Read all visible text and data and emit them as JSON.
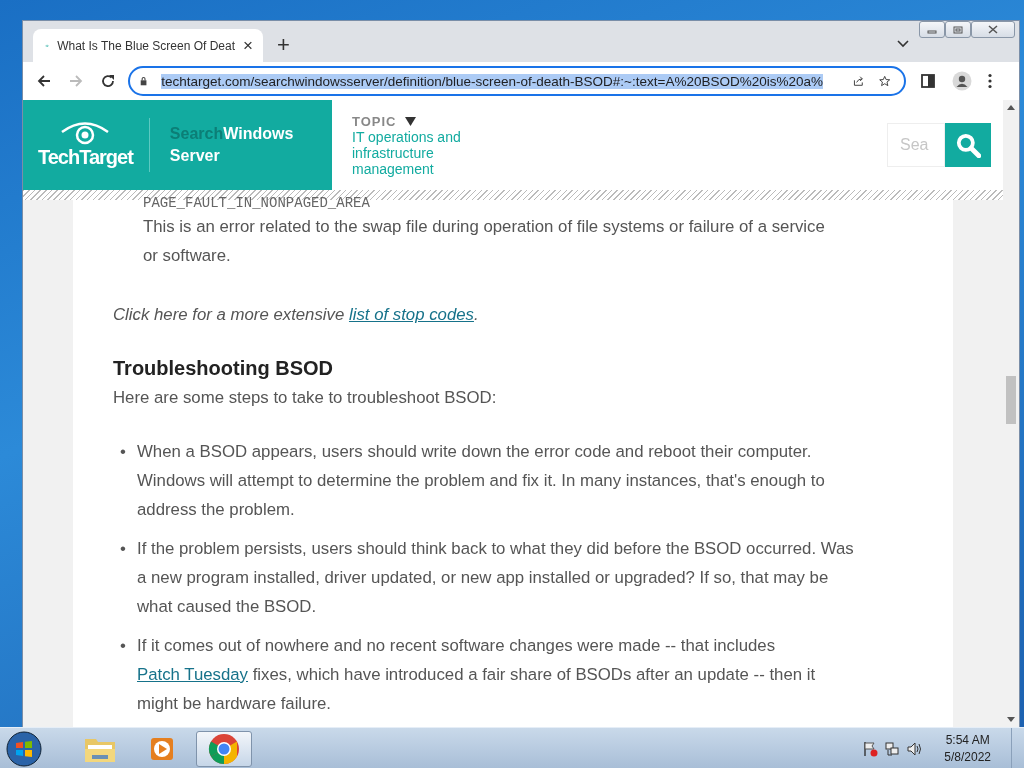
{
  "browser": {
    "tab": {
      "title": "What Is The Blue Screen Of Deat",
      "close": "×",
      "selected": true
    },
    "new_tab": "+",
    "address": {
      "url": "techtarget.com/searchwindowsserver/definition/blue-screen-of-death-BSOD#:~:text=A%20BSOD%20is%20a%",
      "text_selected": true
    },
    "forward_disabled": true
  },
  "site_header": {
    "logo": "TechTarget",
    "brand": [
      "Search",
      "Windows",
      "Server"
    ],
    "topic_label": "TOPIC",
    "topic": "IT operations and infrastructure management",
    "search": {
      "placeholder": "Sea"
    }
  },
  "article": {
    "code": "PAGE_FAULT_IN_NONPAGED_AREA",
    "code_description": "This is an error related to the swap file during operation of file systems or failure of a service or software.",
    "more": {
      "prefix": "Click here for a more extensive ",
      "link": "list of stop codes",
      "suffix": "."
    },
    "heading": "Troubleshooting BSOD",
    "intro": "Here are some steps to take to troubleshoot BSOD:",
    "bullets": [
      {
        "marker": "•",
        "parts": [
          {
            "kind": "text",
            "text": "When a BSOD appears, users should write down the error code and reboot their computer. Windows will attempt to determine the problem and fix it. In many instances, that's enough to address the problem."
          }
        ]
      },
      {
        "marker": "•",
        "parts": [
          {
            "kind": "text",
            "text": "If the problem persists, users should think back to what they did before the BSOD occurred. Was a new program installed, driver updated, or new app installed or upgraded? If so, that may be what caused the BSOD."
          }
        ]
      },
      {
        "marker": "•",
        "parts": [
          {
            "kind": "text",
            "text": "If it comes out of nowhere and no recent software changes were made -- that includes "
          },
          {
            "kind": "link",
            "text": "Patch Tuesday"
          },
          {
            "kind": "text",
            "text": " fixes, which have introduced a fair share of BSODs after an update -- then it might be hardware failure."
          }
        ]
      }
    ]
  },
  "taskbar": {
    "time": "5:54 AM",
    "date": "5/8/2022",
    "apps": [
      {
        "kind": "folder",
        "selected": false
      },
      {
        "kind": "media",
        "selected": false
      },
      {
        "kind": "chrome",
        "selected": true
      }
    ]
  }
}
